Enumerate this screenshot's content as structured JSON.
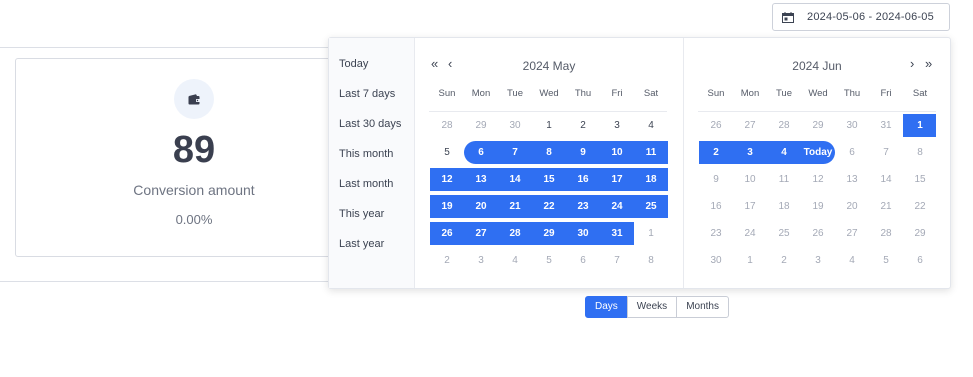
{
  "header": {
    "date_range": "2024-05-06 - 2024-06-05",
    "icon": "calendar-icon"
  },
  "stat": {
    "icon": "wallet-icon",
    "value": "89",
    "label": "Conversion amount",
    "percent": "0.00%"
  },
  "presets": [
    "Today",
    "Last 7 days",
    "Last 30 days",
    "This month",
    "Last month",
    "This year",
    "Last year"
  ],
  "weekdays": [
    "Sun",
    "Mon",
    "Tue",
    "Wed",
    "Thu",
    "Fri",
    "Sat"
  ],
  "months": [
    {
      "title": "2024 May",
      "rows": [
        [
          "28",
          "29",
          "30",
          "1",
          "2",
          "3",
          "4"
        ],
        [
          "5",
          "6",
          "7",
          "8",
          "9",
          "10",
          "11"
        ],
        [
          "12",
          "13",
          "14",
          "15",
          "16",
          "17",
          "18"
        ],
        [
          "19",
          "20",
          "21",
          "22",
          "23",
          "24",
          "25"
        ],
        [
          "26",
          "27",
          "28",
          "29",
          "30",
          "31",
          "1"
        ],
        [
          "2",
          "3",
          "4",
          "5",
          "6",
          "7",
          "8"
        ]
      ],
      "out": [
        [
          0,
          0
        ],
        [
          0,
          1
        ],
        [
          0,
          2
        ],
        [
          4,
          6
        ],
        [
          5,
          0
        ],
        [
          5,
          1
        ],
        [
          5,
          2
        ],
        [
          5,
          3
        ],
        [
          5,
          4
        ],
        [
          5,
          5
        ],
        [
          5,
          6
        ]
      ]
    },
    {
      "title": "2024 Jun",
      "rows": [
        [
          "26",
          "27",
          "28",
          "29",
          "30",
          "31",
          "1"
        ],
        [
          "2",
          "3",
          "4",
          "Today",
          "6",
          "7",
          "8"
        ],
        [
          "9",
          "10",
          "11",
          "12",
          "13",
          "14",
          "15"
        ],
        [
          "16",
          "17",
          "18",
          "19",
          "20",
          "21",
          "22"
        ],
        [
          "23",
          "24",
          "25",
          "26",
          "27",
          "28",
          "29"
        ],
        [
          "30",
          "1",
          "2",
          "3",
          "4",
          "5",
          "6"
        ]
      ],
      "out": [
        [
          0,
          0
        ],
        [
          0,
          1
        ],
        [
          0,
          2
        ],
        [
          0,
          3
        ],
        [
          0,
          4
        ],
        [
          0,
          5
        ],
        [
          1,
          4
        ],
        [
          1,
          5
        ],
        [
          1,
          6
        ],
        [
          2,
          0
        ],
        [
          2,
          1
        ],
        [
          2,
          2
        ],
        [
          2,
          3
        ],
        [
          2,
          4
        ],
        [
          2,
          5
        ],
        [
          2,
          6
        ],
        [
          3,
          0
        ],
        [
          3,
          1
        ],
        [
          3,
          2
        ],
        [
          3,
          3
        ],
        [
          3,
          4
        ],
        [
          3,
          5
        ],
        [
          3,
          6
        ],
        [
          4,
          0
        ],
        [
          4,
          1
        ],
        [
          4,
          2
        ],
        [
          4,
          3
        ],
        [
          4,
          4
        ],
        [
          4,
          5
        ],
        [
          4,
          6
        ],
        [
          5,
          0
        ],
        [
          5,
          1
        ],
        [
          5,
          2
        ],
        [
          5,
          3
        ],
        [
          5,
          4
        ],
        [
          5,
          5
        ],
        [
          5,
          6
        ]
      ]
    }
  ],
  "granularity": {
    "options": [
      "Days",
      "Weeks",
      "Months"
    ],
    "selected": "Days"
  },
  "colors": {
    "accent": "#2f6ff2"
  }
}
